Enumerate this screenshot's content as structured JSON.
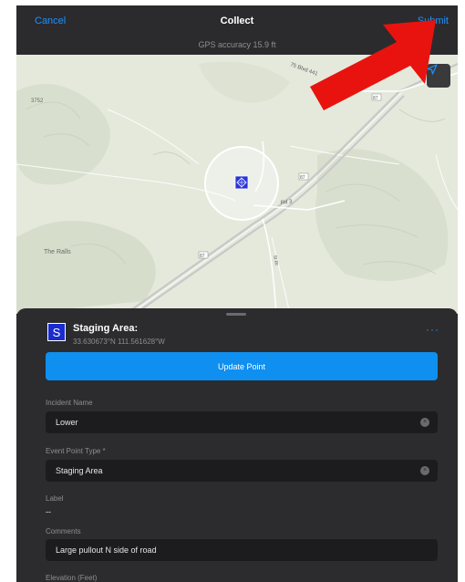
{
  "header": {
    "cancel": "Cancel",
    "title": "Collect",
    "submit": "Submit",
    "gps_accuracy": "GPS accuracy 15.9 ft"
  },
  "map": {
    "labels": {
      "r1": "75 Blvd 441",
      "r2": "87",
      "r3": "87",
      "r4": "87",
      "r5": "Rd 3",
      "r6": "St Rt",
      "ralls": "The Ralls",
      "peak": "3752"
    },
    "location_icon": "navigation-arrow-icon"
  },
  "sheet": {
    "badge": "S",
    "point_title": "Staging Area:",
    "coords": "33.630673°N 111.561628°W",
    "more": "···",
    "update_button": "Update Point",
    "fields": {
      "incident_label": "Incident Name",
      "incident_value": "Lower",
      "event_type_label": "Event Point Type *",
      "event_type_value": "Staging Area",
      "label_label": "Label",
      "label_value": "--",
      "comments_label": "Comments",
      "comments_value": "Large pullout N side of road",
      "elevation_label": "Elevation (Feet)"
    },
    "clear_symbol": "×"
  },
  "colors": {
    "accent": "#1e90ff",
    "button": "#0f8ff0",
    "annotation_arrow": "#e8130f"
  }
}
